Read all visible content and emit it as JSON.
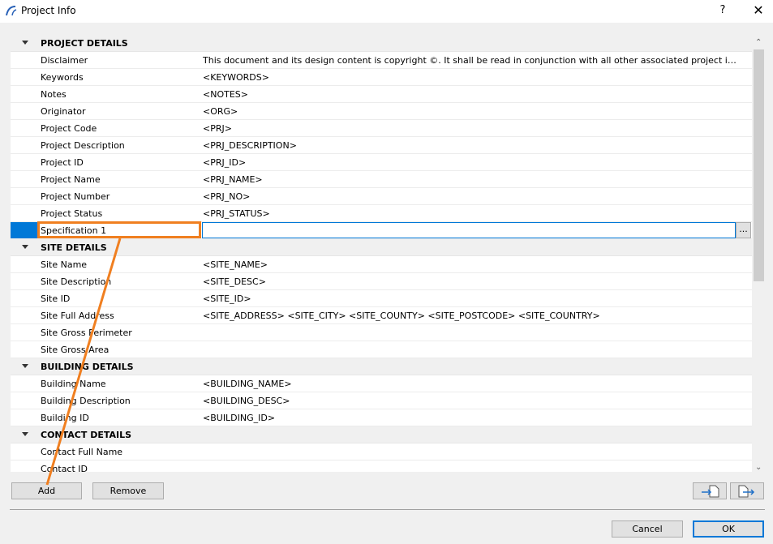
{
  "window": {
    "title": "Project Info",
    "help_label": "?",
    "close_label": "✕"
  },
  "rows": [
    {
      "type": "header",
      "name": "PROJECT DETAILS",
      "value": ""
    },
    {
      "type": "item",
      "name": "Disclaimer",
      "value": "This document and its design content is copyright ©. It shall be read in conjunction with all other associated project informat..."
    },
    {
      "type": "item",
      "name": "Keywords",
      "value": "<KEYWORDS>"
    },
    {
      "type": "item",
      "name": "Notes",
      "value": "<NOTES>"
    },
    {
      "type": "item",
      "name": "Originator",
      "value": "<ORG>"
    },
    {
      "type": "item",
      "name": "Project Code",
      "value": "<PRJ>"
    },
    {
      "type": "item",
      "name": "Project Description",
      "value": "<PRJ_DESCRIPTION>"
    },
    {
      "type": "item",
      "name": "Project ID",
      "value": "<PRJ_ID>"
    },
    {
      "type": "item",
      "name": "Project Name",
      "value": "<PRJ_NAME>"
    },
    {
      "type": "item",
      "name": "Project Number",
      "value": "<PRJ_NO>"
    },
    {
      "type": "item",
      "name": "Project Status",
      "value": "<PRJ_STATUS>"
    },
    {
      "type": "selected",
      "name": "Specification 1",
      "value": "",
      "button": "..."
    },
    {
      "type": "header",
      "name": "SITE DETAILS",
      "value": ""
    },
    {
      "type": "item",
      "name": "Site Name",
      "value": "<SITE_NAME>"
    },
    {
      "type": "item",
      "name": "Site Description",
      "value": "<SITE_DESC>"
    },
    {
      "type": "item",
      "name": "Site ID",
      "value": "<SITE_ID>"
    },
    {
      "type": "item",
      "name": "Site Full Address",
      "value": "<SITE_ADDRESS> <SITE_CITY> <SITE_COUNTY> <SITE_POSTCODE> <SITE_COUNTRY>"
    },
    {
      "type": "item",
      "name": "Site Gross Perimeter",
      "value": ""
    },
    {
      "type": "item",
      "name": "Site Gross Area",
      "value": ""
    },
    {
      "type": "header",
      "name": "BUILDING DETAILS",
      "value": ""
    },
    {
      "type": "item",
      "name": "Building Name",
      "value": "<BUILDING_NAME>"
    },
    {
      "type": "item",
      "name": "Building Description",
      "value": "<BUILDING_DESC>"
    },
    {
      "type": "item",
      "name": "Building ID",
      "value": "<BUILDING_ID>"
    },
    {
      "type": "header",
      "name": "CONTACT DETAILS",
      "value": ""
    },
    {
      "type": "item",
      "name": "Contact Full Name",
      "value": ""
    },
    {
      "type": "item",
      "name": "Contact ID",
      "value": ""
    }
  ],
  "buttons": {
    "add": "Add",
    "remove": "Remove",
    "cancel": "Cancel",
    "ok": "OK"
  },
  "scroll": {
    "up": "⌃",
    "down": "⌄"
  },
  "colors": {
    "accent": "#0078d7",
    "annotation": "#f07f20"
  }
}
